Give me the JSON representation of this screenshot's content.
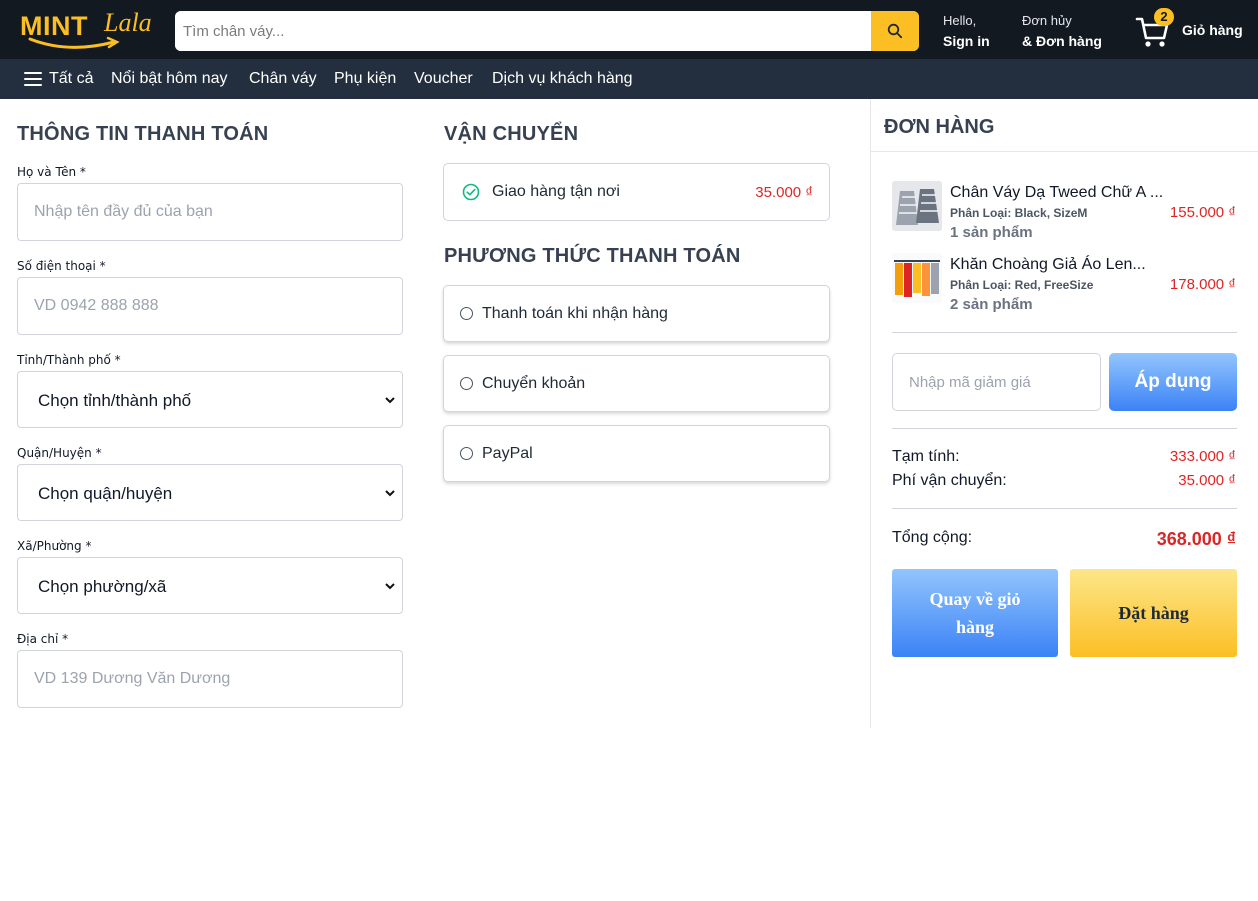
{
  "header": {
    "logo_main": "MINT",
    "logo_script": "Lala",
    "search_placeholder": "Tìm chân váy...",
    "hello_small": "Hello,",
    "hello_bold": "Sign in",
    "orders_small": "Đơn hủy",
    "orders_bold": "& Đơn hàng",
    "cart_count": "2",
    "cart_label": "Giỏ hàng",
    "accent": "#fbbf24"
  },
  "nav": {
    "items": [
      "Tất cả",
      "Nổi bật hôm nay",
      "Chân váy",
      "Phụ kiện",
      "Voucher",
      "Dịch vụ khách hàng"
    ]
  },
  "billing": {
    "title": "THÔNG TIN THANH TOÁN",
    "fullname_label": "Họ và Tên *",
    "fullname_placeholder": "Nhập tên đầy đủ của bạn",
    "phone_label": "Số điện thoại *",
    "phone_placeholder": "VD 0942 888 888",
    "province_label": "Tỉnh/Thành phố *",
    "province_value": "Chọn tỉnh/thành phố",
    "district_label": "Quận/Huyện *",
    "district_value": "Chọn quận/huyện",
    "ward_label": "Xã/Phường *",
    "ward_value": "Chọn phường/xã",
    "address_label": "Địa chỉ *",
    "address_placeholder": "VD 139 Dương Văn Dương"
  },
  "shipping": {
    "title": "VẬN CHUYỂN",
    "option_label": "Giao hàng tận nơi",
    "option_price": "35.000 ₫"
  },
  "payment": {
    "title": "PHƯƠNG THỨC THANH TOÁN",
    "methods": [
      "Thanh toán khi nhận hàng",
      "Chuyển khoản",
      "PayPal"
    ]
  },
  "order": {
    "title": "ĐƠN HÀNG",
    "products": [
      {
        "name": "Chân Váy Dạ Tweed Chữ A ...",
        "variant": "Phân Loại:  Black,  SizeM",
        "qty": "1 sản phẩm",
        "price": "155.000 ₫"
      },
      {
        "name": "Khăn Choàng Giả Áo Len...",
        "variant": "Phân Loại:  Red,  FreeSize",
        "qty": "2 sản phẩm",
        "price": "178.000 ₫"
      }
    ],
    "coupon_placeholder": "Nhập mã giảm giá",
    "apply_label": "Áp dụng",
    "subtotal_label": "Tạm tính:",
    "subtotal_value": "333.000 ₫",
    "shipping_label": "Phí vận chuyển:",
    "shipping_value": "35.000 ₫",
    "total_label": "Tổng cộng:",
    "total_value": "368.000 ₫",
    "back_label": "Quay về giỏ hàng",
    "place_order_label": "Đặt hàng",
    "price_color": "#dc2626"
  }
}
